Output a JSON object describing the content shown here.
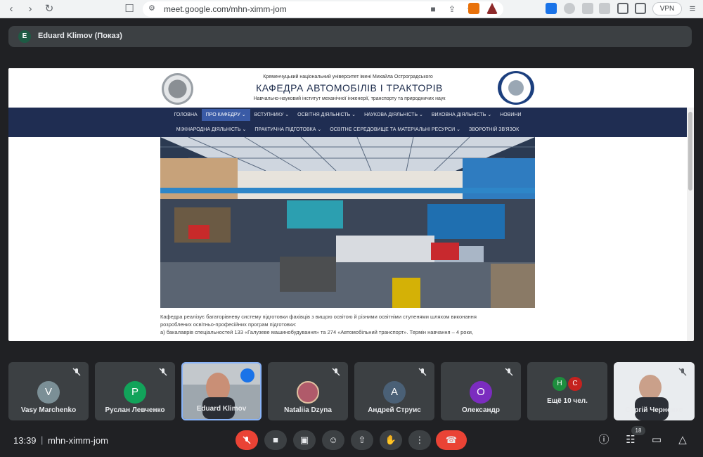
{
  "browser": {
    "url": "meet.google.com/mhn-ximm-jom",
    "vpn_label": "VPN"
  },
  "presenter": {
    "avatar_letter": "E",
    "label": "Eduard Klimov (Показ)"
  },
  "site": {
    "university": "Кременчуцький національний університет імені Михайла Остроградського",
    "department": "КАФЕДРА АВТОМОБІЛІВ І ТРАКТОРІВ",
    "institute": "Навчально-науковий інститут механічної інженерії, транспорту та природничих наук",
    "nav_row1": [
      {
        "label": "ГОЛОВНА"
      },
      {
        "label": "ПРО КАФЕДРУ ⌄"
      },
      {
        "label": "ВСТУПНИКУ ⌄"
      },
      {
        "label": "ОСВІТНЯ ДІЯЛЬНІСТЬ ⌄"
      },
      {
        "label": "НАУКОВА ДІЯЛЬНІСТЬ ⌄"
      },
      {
        "label": "ВИХОВНА ДІЯЛЬНІСТЬ ⌄"
      },
      {
        "label": "НОВИНИ"
      }
    ],
    "nav_row2": [
      {
        "label": "МІЖНАРОДНА ДІЯЛЬНІСТЬ ⌄"
      },
      {
        "label": "ПРАКТИЧНА ПІДГОТОВКА ⌄"
      },
      {
        "label": "ОСВІТНЄ СЕРЕДОВИЩЕ ТА МАТЕРІАЛЬНІ РЕСУРСИ ⌄"
      },
      {
        "label": "ЗВОРОТНІЙ ЗВ'ЯЗОК"
      }
    ],
    "active_nav": "ПРО КАФЕДРУ",
    "body_lines": [
      "Кафедра реалізує багаторівневу систему підготовки фахівців з вищою освітою й різними освітніми ступенями шляхом виконання",
      "розроблених освітньо-професійних програм підготовки:",
      "а) бакалаврів спеціальностей 133 «Галузеве машинобудування» та 274 «Автомобільний транспорт». Термін навчання – 4 роки,"
    ]
  },
  "participants": [
    {
      "name": "Vasy Marchenko",
      "initial": "V",
      "color": "#7b8f96",
      "muted": true
    },
    {
      "name": "Руслан Левченко",
      "initial": "Р",
      "color": "#12a35a",
      "muted": true
    },
    {
      "name": "Eduard Klimov",
      "video": true,
      "speaking": true
    },
    {
      "name": "Nataliia Dzyna",
      "photo": true,
      "muted": true
    },
    {
      "name": "Андрей Струис",
      "initial": "A",
      "color": "#4a6076",
      "muted": true
    },
    {
      "name": "Олександр",
      "initial": "O",
      "color": "#7b2cbf",
      "muted": true
    },
    {
      "name": "Ещё 10 чел.",
      "initials": [
        "H",
        "C"
      ],
      "colors": [
        "#1e8e3e",
        "#c5221f"
      ]
    },
    {
      "name": "Сергій Черненко",
      "video": true,
      "muted": true
    }
  ],
  "bottom": {
    "time": "13:39",
    "separator": "|",
    "meeting_code": "mhn-ximm-jom",
    "people_count": "18"
  }
}
